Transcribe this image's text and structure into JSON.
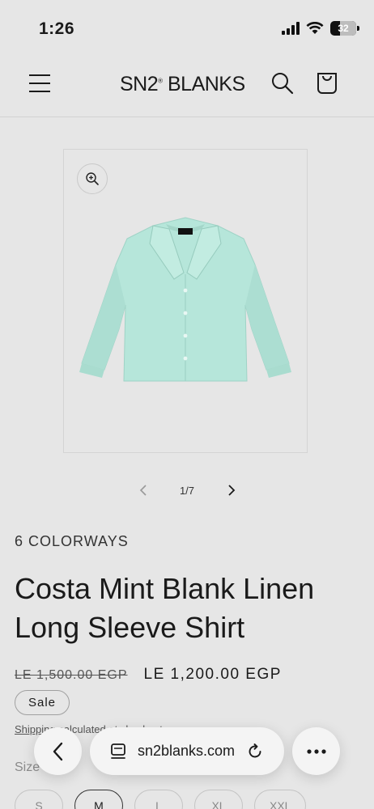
{
  "status": {
    "time": "1:26",
    "battery": "32"
  },
  "header": {
    "logo": "SN2",
    "logo_mark": "®",
    "logo_rest": "BLANKS"
  },
  "gallery": {
    "product_image": "mint linen long sleeve shirt",
    "counter": "1/7"
  },
  "product": {
    "colorways": "6 COLORWAYS",
    "title": "Costa Mint Blank Linen Long Sleeve Shirt",
    "price_regular": "LE 1,500.00 EGP",
    "price_sale": "LE 1,200.00 EGP",
    "sale_badge": "Sale",
    "shipping_link": "Shipping",
    "shipping_rest": " calculated at checkout.",
    "size_label": "Size",
    "sizes": [
      "S",
      "M",
      "L",
      "XL",
      "XXL"
    ],
    "selected_size": "M"
  },
  "browser": {
    "url": "sn2blanks.com"
  },
  "colors": {
    "background": "#e6e6e6",
    "shirt": "#b6e6da",
    "text": "#1a1a1a"
  }
}
